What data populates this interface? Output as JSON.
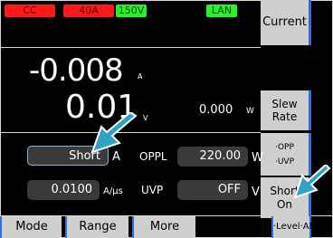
{
  "status": {
    "mode": "CC",
    "range_amp": "40A",
    "range_volt": "150V",
    "lan": "LAN"
  },
  "softkeys": {
    "current": "Current",
    "slew_rate": [
      "Slew",
      "Rate"
    ],
    "protection": [
      "·OPP",
      "·UVP"
    ],
    "short_on": [
      "Short",
      "On"
    ]
  },
  "readings": {
    "current": "-0.008",
    "current_unit": "A",
    "voltage": "0.01",
    "voltage_unit": "V",
    "power": "0.000",
    "power_unit": "W"
  },
  "settings": {
    "setpoint": "Short",
    "setpoint_unit": "A",
    "oppl_label": "OPPL",
    "oppl_value": "220.00",
    "oppl_unit": "W",
    "slew_value": "0.0100",
    "slew_unit": "A/µs",
    "uvp_label": "UVP",
    "uvp_value": "OFF",
    "uvp_unit": "V"
  },
  "bottom": {
    "mode": "Mode",
    "range": "Range",
    "more": "More",
    "level": "·Level·ABC"
  },
  "colors": {
    "status_red": "#ff1a1a",
    "status_green": "#27f127",
    "accent_blue": "#2f6fd6",
    "arrow": "#2ea3c6"
  }
}
